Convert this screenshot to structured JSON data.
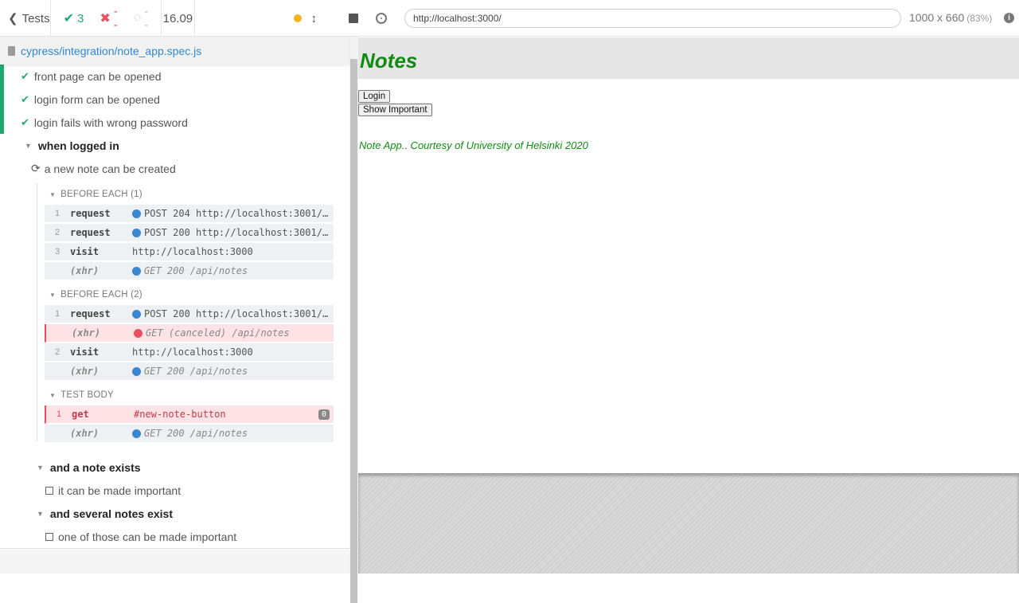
{
  "topbar": {
    "back_label": "Tests",
    "passed": "3",
    "failed": "--",
    "pending": "--",
    "duration": "16.09"
  },
  "spec": {
    "path": "cypress/integration/note_app.spec.js"
  },
  "tests": {
    "t1": "front page can be opened",
    "t2": "login form can be opened",
    "t3": "login fails with wrong password",
    "suite_logged_in": "when logged in",
    "t_running": "a new note can be created",
    "suite_note_exists": "and a note exists",
    "t_important": "it can be made important",
    "suite_several": "and several notes exist",
    "t_several": "one of those can be made important"
  },
  "hooks": {
    "before_each_1": "BEFORE EACH (1)",
    "before_each_2": "BEFORE EACH (2)",
    "test_body": "TEST BODY"
  },
  "commands": {
    "be1": [
      {
        "num": "1",
        "name": "request",
        "msg": "POST 204 http://localhost:3001/…"
      },
      {
        "num": "2",
        "name": "request",
        "msg": "POST 200 http://localhost:3001/…"
      },
      {
        "num": "3",
        "name": "visit",
        "msg": "http://localhost:3000"
      },
      {
        "num": "",
        "name": "(xhr)",
        "msg": "GET 200 /api/notes"
      }
    ],
    "be2": [
      {
        "num": "1",
        "name": "request",
        "msg": "POST 200 http://localhost:3001/…"
      },
      {
        "num": "",
        "name": "(xhr)",
        "msg": "GET (canceled) /api/notes"
      },
      {
        "num": "2",
        "name": "visit",
        "msg": "http://localhost:3000"
      },
      {
        "num": "",
        "name": "(xhr)",
        "msg": "GET 200 /api/notes"
      }
    ],
    "body": [
      {
        "num": "1",
        "name": "get",
        "msg": "#new-note-button",
        "badge": "0"
      },
      {
        "num": "",
        "name": "(xhr)",
        "msg": "GET 200 /api/notes"
      }
    ]
  },
  "aut": {
    "url": "http://localhost:3000/",
    "viewport": "1000 x 660",
    "scale": "(83%)",
    "info": "i"
  },
  "app": {
    "title": "Notes",
    "login_label": "Login",
    "show_important_label": "Show Important",
    "footer": "Note App.. Courtesy of University of Helsinki 2020"
  },
  "colors": {
    "pass": "#1fa971",
    "fail": "#e94f5f",
    "link": "#2e88d4",
    "app_green": "#138a13",
    "xhr_dot": "#3a86d0"
  },
  "icons": {
    "back": "chevron-left-icon",
    "pass": "check-icon",
    "fail": "x-icon",
    "pending": "spinner-icon",
    "crosshair": "crosshair-icon",
    "info": "info-icon"
  }
}
